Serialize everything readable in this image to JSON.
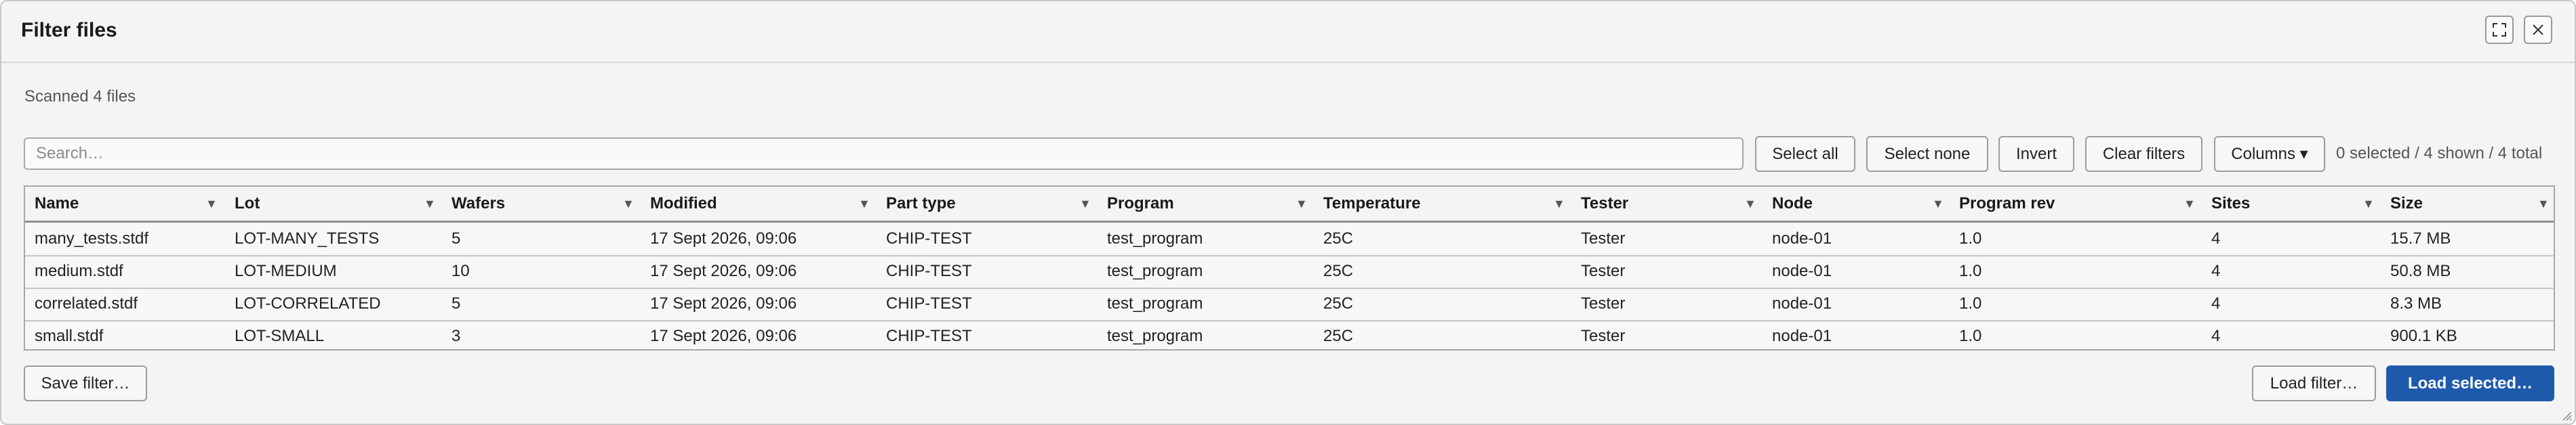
{
  "dialog": {
    "title": "Filter files",
    "maximize_icon": "maximize-icon",
    "close_icon": "close-icon"
  },
  "status": {
    "scanned": "Scanned 4 files"
  },
  "search": {
    "placeholder": "Search…",
    "value": ""
  },
  "toolbar": {
    "select_all": "Select all",
    "select_none": "Select none",
    "invert": "Invert",
    "clear_filters": "Clear filters",
    "columns": "Columns ▾",
    "counts": "0 selected / 4 shown / 4 total"
  },
  "table": {
    "sort_icon": "▼",
    "columns": [
      "Name",
      "Lot",
      "Wafers",
      "Modified",
      "Part type",
      "Program",
      "Temperature",
      "Tester",
      "Node",
      "Program rev",
      "Sites",
      "Size"
    ],
    "rows": [
      [
        "many_tests.stdf",
        "LOT-MANY_TESTS",
        "5",
        "17 Sept 2026, 09:06",
        "CHIP-TEST",
        "test_program",
        "25C",
        "Tester",
        "node-01",
        "1.0",
        "4",
        "15.7 MB"
      ],
      [
        "medium.stdf",
        "LOT-MEDIUM",
        "10",
        "17 Sept 2026, 09:06",
        "CHIP-TEST",
        "test_program",
        "25C",
        "Tester",
        "node-01",
        "1.0",
        "4",
        "50.8 MB"
      ],
      [
        "correlated.stdf",
        "LOT-CORRELATED",
        "5",
        "17 Sept 2026, 09:06",
        "CHIP-TEST",
        "test_program",
        "25C",
        "Tester",
        "node-01",
        "1.0",
        "4",
        "8.3 MB"
      ],
      [
        "small.stdf",
        "LOT-SMALL",
        "3",
        "17 Sept 2026, 09:06",
        "CHIP-TEST",
        "test_program",
        "25C",
        "Tester",
        "node-01",
        "1.0",
        "4",
        "900.1 KB"
      ]
    ]
  },
  "footer": {
    "save_filter": "Save filter…",
    "load_filter": "Load filter…",
    "load_selected": "Load selected…"
  },
  "colors": {
    "primary": "#1e5aab",
    "background": "#f4f4f4",
    "border": "#a8a8a8"
  }
}
